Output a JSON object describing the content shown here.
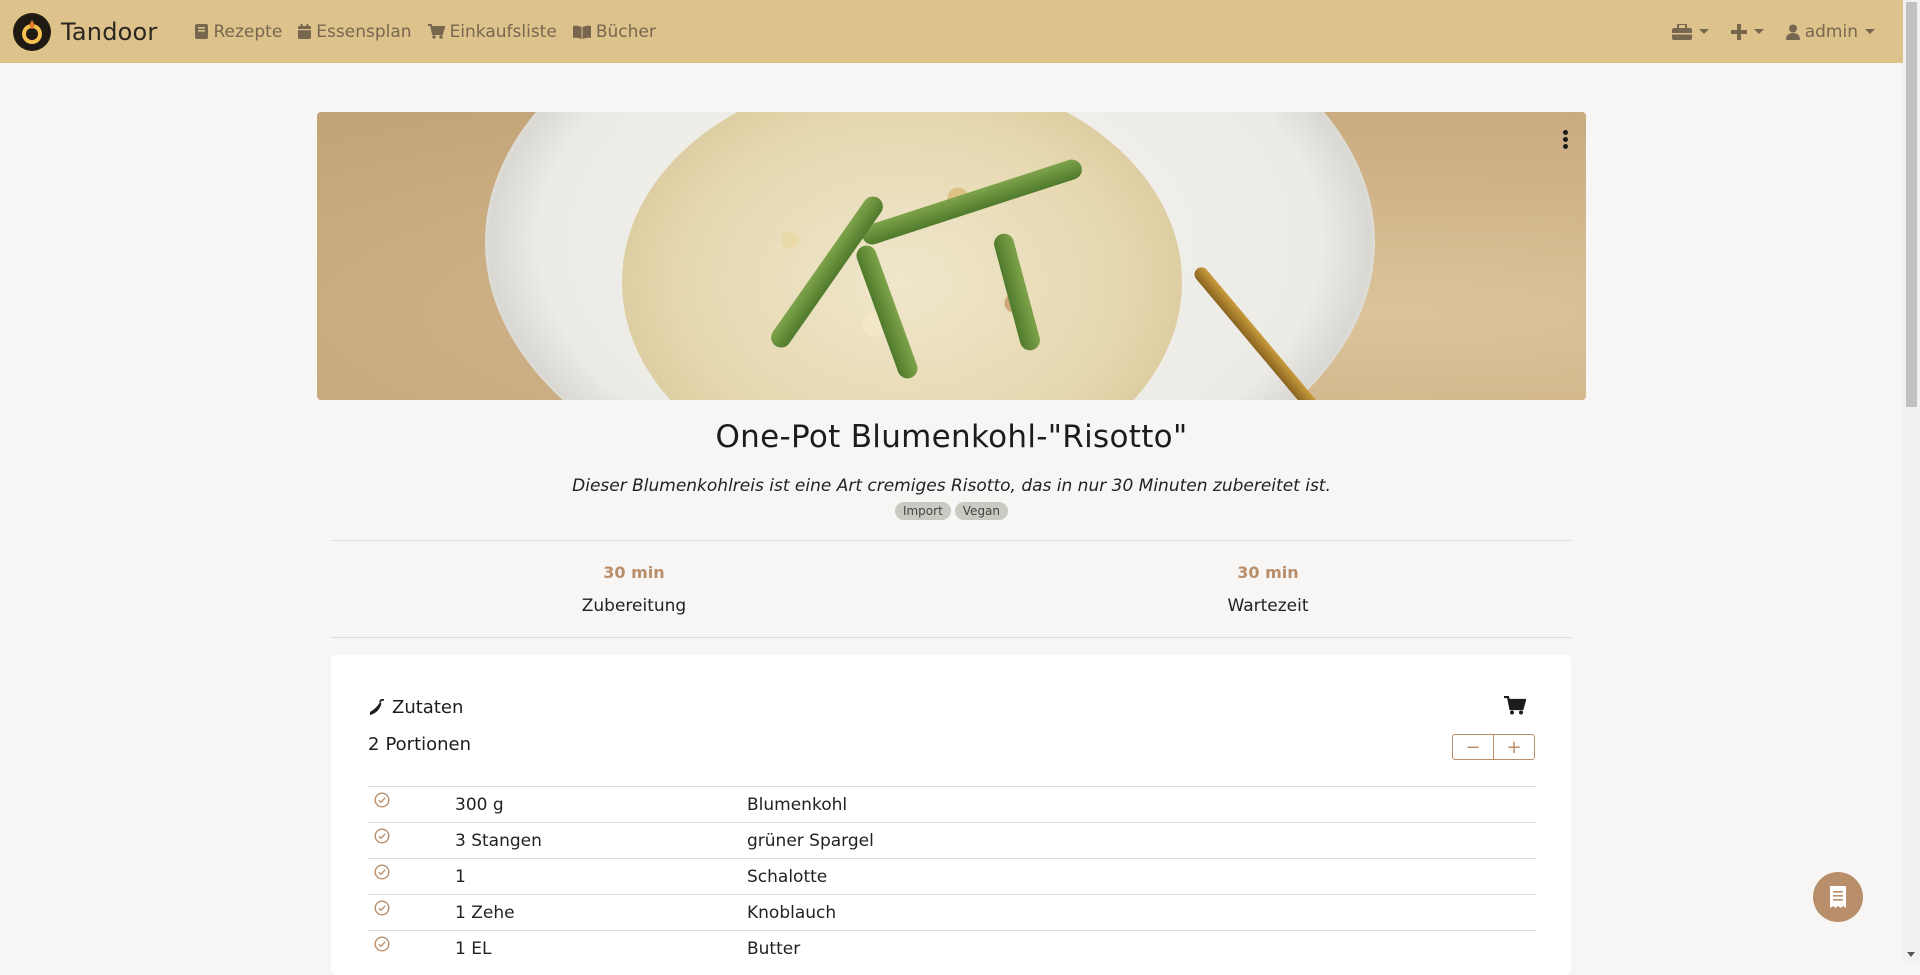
{
  "nav": {
    "brand": "Tandoor",
    "links": [
      {
        "label": "Rezepte",
        "icon": "book-icon"
      },
      {
        "label": "Essensplan",
        "icon": "calendar-icon"
      },
      {
        "label": "Einkaufsliste",
        "icon": "cart-icon"
      },
      {
        "label": "Bücher",
        "icon": "open-book-icon"
      }
    ],
    "user": "admin"
  },
  "recipe": {
    "title": "One-Pot Blumenkohl-\"Risotto\"",
    "description": "Dieser Blumenkohlreis ist eine Art cremiges Risotto, das in nur 30 Minuten zubereitet ist.",
    "keywords": [
      "Import",
      "Vegan"
    ],
    "times": [
      {
        "value": "30 min",
        "label": "Zubereitung"
      },
      {
        "value": "30 min",
        "label": "Wartezeit"
      }
    ]
  },
  "ingredients": {
    "heading": "Zutaten",
    "portions_count": "2",
    "portions_label": "Portionen",
    "minus": "−",
    "plus": "+",
    "rows": [
      {
        "amount": "300 g",
        "name": "Blumenkohl"
      },
      {
        "amount": "3 Stangen",
        "name": "grüner Spargel"
      },
      {
        "amount": "1",
        "name": "Schalotte"
      },
      {
        "amount": "1 Zehe",
        "name": "Knoblauch"
      },
      {
        "amount": "1 EL",
        "name": "Butter"
      }
    ]
  },
  "colors": {
    "navbar": "#ddc28c",
    "accent": "#b98e6b",
    "nav_text": "#77674f",
    "background": "#f7f6f5"
  }
}
